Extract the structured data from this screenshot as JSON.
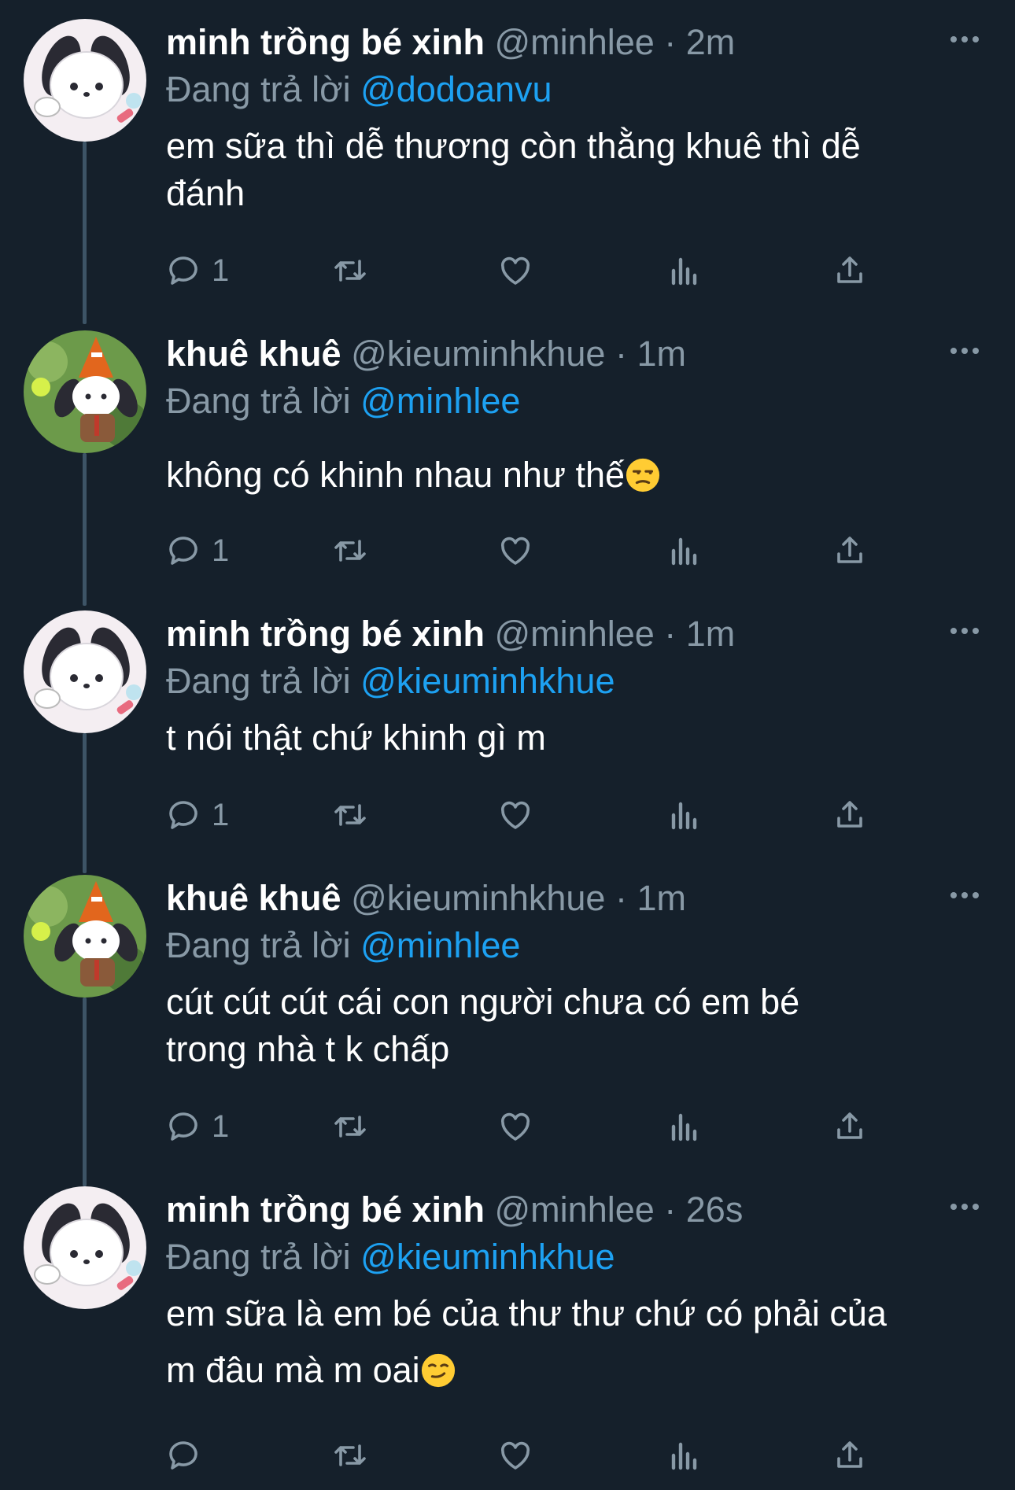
{
  "colors": {
    "background": "#15202b",
    "name": "#ffffff",
    "secondary": "#8899a6",
    "mention": "#1da1f2",
    "thread_line": "#3d5466"
  },
  "labels": {
    "replying_to": "Đang trả lời"
  },
  "tweets": [
    {
      "name": "minh trồng bé xinh",
      "handle": "@minhlee",
      "time": "· 2m",
      "mention": "@dodoanvu",
      "text_lines": [
        "em sữa thì dễ thương còn thằng khuê thì dễ",
        "đánh"
      ],
      "reply_count": "1",
      "avatar": "pochacco-avatar",
      "emoji": ""
    },
    {
      "name": "khuê khuê",
      "handle": "@kieuminhkhue",
      "time": "· 1m",
      "mention": "@minhlee",
      "text_lines": [
        "không có khinh nhau như thế"
      ],
      "reply_count": "1",
      "avatar": "pochacco-traffic-cone-avatar",
      "emoji": "unamused-face-emoji"
    },
    {
      "name": "minh trồng bé xinh",
      "handle": "@minhlee",
      "time": "· 1m",
      "mention": "@kieuminhkhue",
      "text_lines": [
        "t nói thật chứ khinh gì m"
      ],
      "reply_count": "1",
      "avatar": "pochacco-avatar",
      "emoji": ""
    },
    {
      "name": "khuê khuê",
      "handle": "@kieuminhkhue",
      "time": "· 1m",
      "mention": "@minhlee",
      "text_lines": [
        "cút cút cút cái con người chưa có em bé",
        "trong nhà t k chấp"
      ],
      "reply_count": "1",
      "avatar": "pochacco-traffic-cone-avatar",
      "emoji": ""
    },
    {
      "name": "minh trồng bé xinh",
      "handle": "@minhlee",
      "time": "· 26s",
      "mention": "@kieuminhkhue",
      "text_lines": [
        "em sữa là em bé của thư thư chứ có phải của",
        "m đâu mà m oai"
      ],
      "reply_count": "",
      "avatar": "pochacco-avatar",
      "emoji": "smirking-face-emoji"
    }
  ]
}
